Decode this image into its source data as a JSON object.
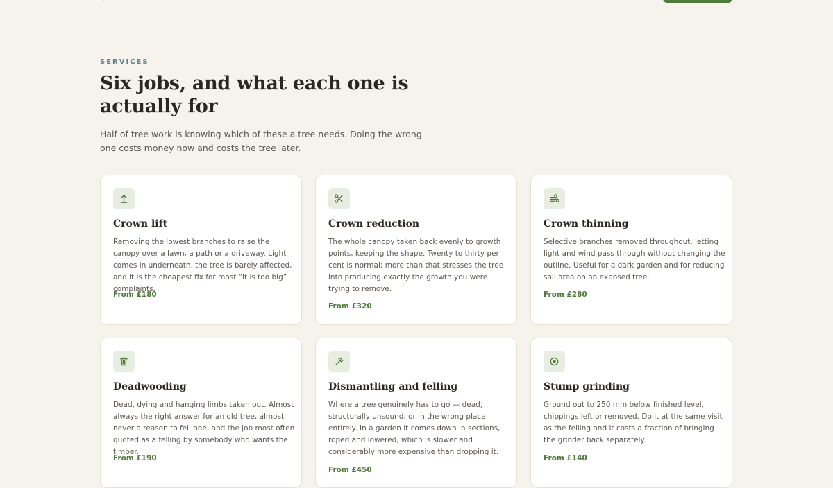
{
  "section": {
    "eyebrow": "SERVICES",
    "headline": "Six jobs, and what each one is actually for",
    "intro": "Half of tree work is knowing which of these a tree needs. Doing the wrong one costs money now and costs the tree later."
  },
  "services": [
    {
      "icon": "arrow-up-icon",
      "title": "Crown lift",
      "description": "Removing the lowest branches to raise the canopy over a lawn, a path or a driveway. Light comes in underneath, the tree is barely affected, and it is the cheapest fix for most “it is too big” complaints.",
      "price": "From £180"
    },
    {
      "icon": "scissors-icon",
      "title": "Crown reduction",
      "description": "The whole canopy taken back evenly to growth points, keeping the shape. Twenty to thirty per cent is normal; more than that stresses the tree into producing exactly the growth you were trying to remove.",
      "price": "From £320"
    },
    {
      "icon": "wind-icon",
      "title": "Crown thinning",
      "description": "Selective branches removed throughout, letting light and wind pass through without changing the outline. Useful for a dark garden and for reducing sail area on an exposed tree.",
      "price": "From £280"
    },
    {
      "icon": "trash-icon",
      "title": "Deadwooding",
      "description": "Dead, dying and hanging limbs taken out. Almost always the right answer for an old tree, almost never a reason to fell one, and the job most often quoted as a felling by somebody who wants the timber.",
      "price": "From £190"
    },
    {
      "icon": "hammer-icon",
      "title": "Dismantling and felling",
      "description": "Where a tree genuinely has to go — dead, structurally unsound, or in the wrong place entirely. In a garden it comes down in sections, roped and lowered, which is slower and considerably more expensive than dropping it.",
      "price": "From £450"
    },
    {
      "icon": "target-icon",
      "title": "Stump grinding",
      "description": "Ground out to 250 mm below finished level, chippings left or removed. Do it at the same visit as the felling and it costs a fraction of bringing the grinder back separately.",
      "price": "From £140"
    }
  ]
}
